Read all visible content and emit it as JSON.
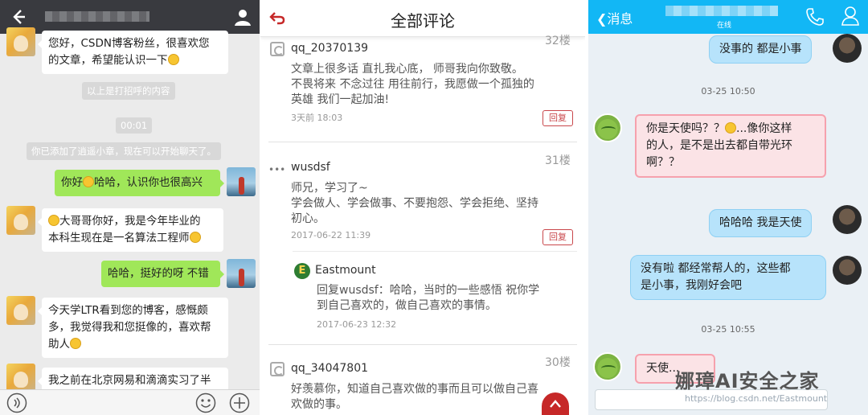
{
  "wechat": {
    "input_icons": [
      "voice-icon",
      "emoji-icon",
      "plus-icon"
    ],
    "messages": [
      {
        "side": "in",
        "lines": [
          "您好，CSDN博客粉丝，很喜欢您",
          "的文章，希望能认识一下"
        ]
      },
      {
        "type": "system",
        "text": "以上是打招呼的内容"
      },
      {
        "type": "system",
        "text": "00:01"
      },
      {
        "type": "system",
        "text": "你已添加了逍遥小章，现在可以开始聊天了。"
      },
      {
        "side": "self",
        "before": "你好",
        "after": "哈哈，认识你也很高兴"
      },
      {
        "side": "in",
        "lines": [
          "大哥哥你好，我是今年毕业的",
          "本科生现在是一名算法工程师"
        ]
      },
      {
        "side": "self",
        "text": "哈哈，挺好的呀 不错"
      },
      {
        "side": "in",
        "lines": [
          "今天学LTR看到您的博客，感慨颇",
          "多，我觉得我和您挺像的，喜欢帮",
          "助人"
        ]
      },
      {
        "side": "in",
        "lines": [
          "我之前在北京网易和滴滴实习了半"
        ]
      }
    ]
  },
  "comments": {
    "title": "全部评论",
    "reply_label": "回复",
    "items": [
      {
        "floor": "32楼",
        "user": "qq_20370139",
        "text": [
          "文章上很多话 直扎我心底， 师哥我向你致敬。",
          "不畏将来 不念过往 用往前行，我愿做一个孤独的",
          "英雄 我们一起加油!"
        ],
        "time": "3天前 18:03"
      },
      {
        "floor": "31楼",
        "user": "wusdsf",
        "text": [
          "师兄，学习了~",
          "学会做人、学会做事、不要抱怨、学会拒绝、坚持",
          "初心。"
        ],
        "time": "2017-06-22 11:39"
      },
      {
        "user": "Eastmount",
        "text": [
          "回复wusdsf：哈哈，当时的一些感悟 祝你学",
          "到自己喜欢的，做自己喜欢的事情。"
        ],
        "time": "2017-06-23 12:32"
      },
      {
        "floor": "30楼",
        "user": "qq_34047801",
        "text": [
          "好羡慕你，知道自己喜欢做的事而且可以做自己喜",
          "欢做的事。"
        ]
      }
    ]
  },
  "qq": {
    "back_label": "消息",
    "status": "在线",
    "messages": [
      {
        "side": "self",
        "text": "没事的 都是小事"
      },
      {
        "type": "time",
        "text": "03-25 10:50"
      },
      {
        "side": "in",
        "style": "pink",
        "lines": [
          "你是天使吗？？",
          "...像你这样",
          "的人，是不是出去都自带光环",
          "啊？？"
        ]
      },
      {
        "side": "self",
        "text": "哈哈哈 我是天使"
      },
      {
        "side": "self",
        "lines": [
          "没有啦 都经常帮人的，这些都",
          "是小事，我刚好会吧"
        ]
      },
      {
        "type": "time",
        "text": "03-25 10:55"
      },
      {
        "side": "in",
        "style": "pink",
        "text": "天使..."
      }
    ],
    "watermark": "https://blog.csdn.net/Eastmount",
    "brand": "娜璋AI安全之家"
  },
  "colors": {
    "wechat_top": "#393a3f",
    "wechat_green": "#a0e759",
    "qq_blue": "#12b7f5",
    "reply_red": "#c9474b"
  }
}
